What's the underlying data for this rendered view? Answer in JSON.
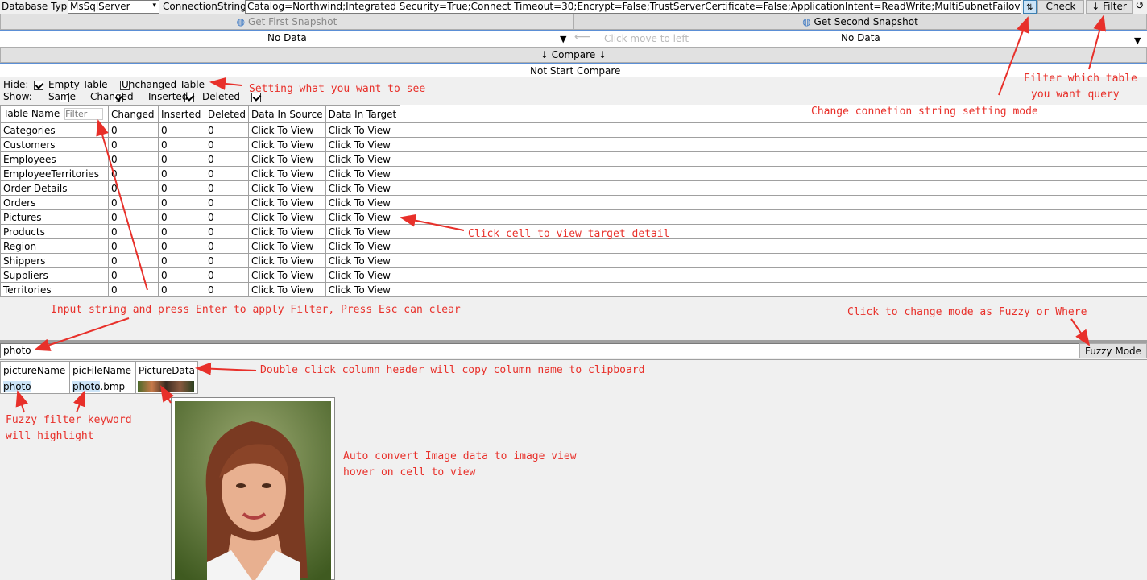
{
  "toolbar": {
    "db_type_label": "Database Type",
    "db_type_value": "MsSqlServer",
    "conn_label": "ConnectionString",
    "conn_value": "Catalog=Northwind;Integrated Security=True;Connect Timeout=30;Encrypt=False;TrustServerCertificate=False;ApplicationIntent=ReadWrite;MultiSubnetFailover=False",
    "check_label": "Check",
    "filter_label": "↓ Filter ↓"
  },
  "snapshots": {
    "first_label": "Get First Snapshot",
    "second_label": "Get Second Snapshot",
    "first_status": "No Data",
    "second_status": "No Data",
    "hint": "Click move to left"
  },
  "compare": {
    "button_label": "↓ Compare ↓",
    "status": "Not Start Compare"
  },
  "options": {
    "hide_label": "Hide:",
    "empty_table": "Empty Table",
    "unchanged_table": "Unchanged Table",
    "show_label": "Show:",
    "same": "Same",
    "changed": "Changed",
    "inserted": "Inserted",
    "deleted": "Deleted"
  },
  "compare_table": {
    "headers": [
      "Table Name",
      "Changed",
      "Inserted",
      "Deleted",
      "Data In Source",
      "Data In Target"
    ],
    "filter_placeholder": "Filter",
    "rows": [
      [
        "Categories",
        "0",
        "0",
        "0",
        "Click To View",
        "Click To View"
      ],
      [
        "Customers",
        "0",
        "0",
        "0",
        "Click To View",
        "Click To View"
      ],
      [
        "Employees",
        "0",
        "0",
        "0",
        "Click To View",
        "Click To View"
      ],
      [
        "EmployeeTerritories",
        "0",
        "0",
        "0",
        "Click To View",
        "Click To View"
      ],
      [
        "Order Details",
        "0",
        "0",
        "0",
        "Click To View",
        "Click To View"
      ],
      [
        "Orders",
        "0",
        "0",
        "0",
        "Click To View",
        "Click To View"
      ],
      [
        "Pictures",
        "0",
        "0",
        "0",
        "Click To View",
        "Click To View"
      ],
      [
        "Products",
        "0",
        "0",
        "0",
        "Click To View",
        "Click To View"
      ],
      [
        "Region",
        "0",
        "0",
        "0",
        "Click To View",
        "Click To View"
      ],
      [
        "Shippers",
        "0",
        "0",
        "0",
        "Click To View",
        "Click To View"
      ],
      [
        "Suppliers",
        "0",
        "0",
        "0",
        "Click To View",
        "Click To View"
      ],
      [
        "Territories",
        "0",
        "0",
        "0",
        "Click To View",
        "Click To View"
      ]
    ]
  },
  "detail": {
    "filter_value": "photo",
    "mode_label": "Fuzzy Mode",
    "headers": [
      "pictureName",
      "picFileName",
      "PictureData"
    ],
    "row": {
      "pictureName_hl": "photo",
      "picFileName_hl": "photo",
      "picFileName_rest": ".bmp"
    }
  },
  "annotations": {
    "setting": "Setting what you want to see",
    "filter_query_1": "Filter which table",
    "filter_query_2": "you want query",
    "conn_mode": "Change connetion string setting mode",
    "click_cell": "Click cell to view target detail",
    "input_filter": "Input string and press Enter to apply Filter, Press Esc can clear",
    "fuzzy_where": "Click to change mode as Fuzzy or Where",
    "double_click": "Double click column header will copy column name to clipboard",
    "fuzzy_hl_1": "Fuzzy filter keyword",
    "fuzzy_hl_2": "will highlight",
    "auto_convert_1": "Auto convert Image data to image view",
    "auto_convert_2": "hover on cell to view"
  },
  "colors": {
    "annotation": "#e8302a",
    "accent_line": "#5b8fd6",
    "highlight": "#cce4f7"
  }
}
